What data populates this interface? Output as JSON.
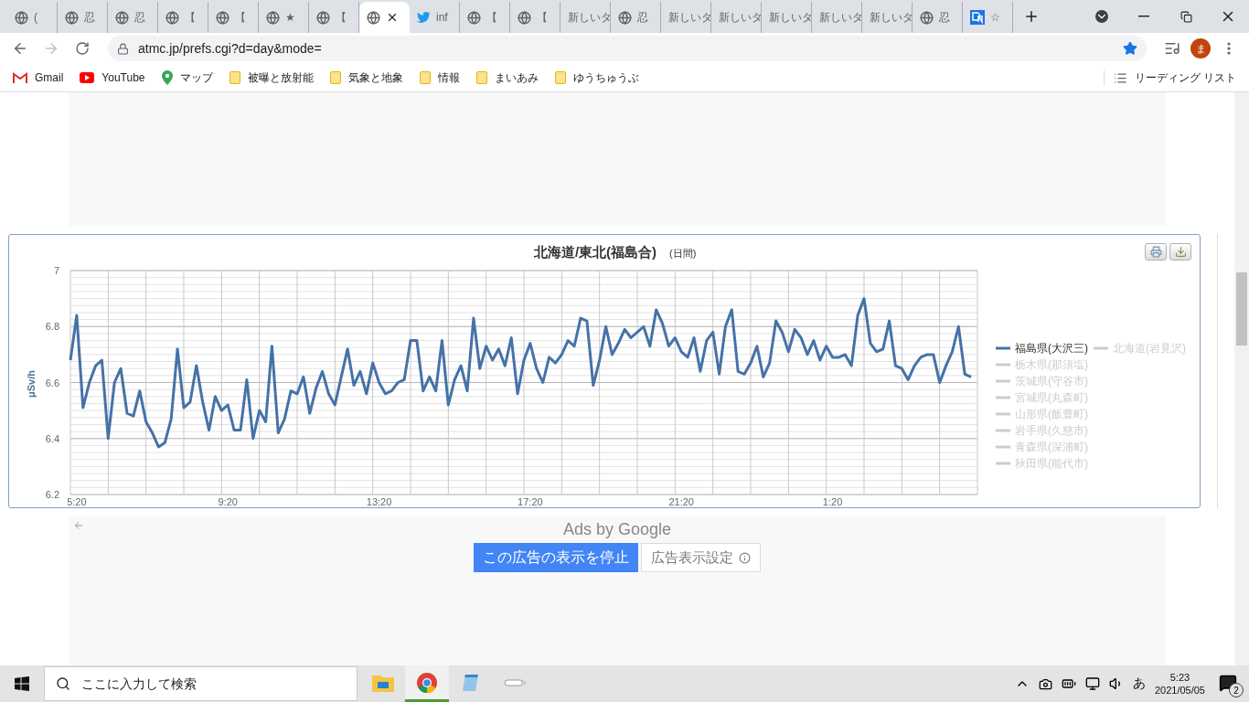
{
  "browser": {
    "tabs": [
      {
        "kind": "globe",
        "label": "(",
        "selected": false
      },
      {
        "kind": "globe",
        "label": "忍",
        "selected": false
      },
      {
        "kind": "globe",
        "label": "忍",
        "selected": false
      },
      {
        "kind": "globe",
        "label": "【",
        "selected": false
      },
      {
        "kind": "globe",
        "label": "【",
        "selected": false
      },
      {
        "kind": "globe",
        "label": "★",
        "selected": false
      },
      {
        "kind": "globe",
        "label": "【",
        "selected": false
      },
      {
        "kind": "globe",
        "selected": true
      },
      {
        "kind": "bird",
        "label": "inf",
        "selected": false
      },
      {
        "kind": "globe",
        "label": "【",
        "selected": false
      },
      {
        "kind": "globe",
        "label": "【",
        "selected": false
      },
      {
        "kind": "plain",
        "label": "新しいタ",
        "selected": false
      },
      {
        "kind": "globe",
        "label": "忍",
        "selected": false
      },
      {
        "kind": "plain",
        "label": "新しいタ",
        "selected": false
      },
      {
        "kind": "plain",
        "label": "新しいタ",
        "selected": false
      },
      {
        "kind": "plain",
        "label": "新しいタ",
        "selected": false
      },
      {
        "kind": "plain",
        "label": "新しいタ",
        "selected": false
      },
      {
        "kind": "plain",
        "label": "新しいタ",
        "selected": false
      },
      {
        "kind": "globe",
        "label": "忍",
        "selected": false
      },
      {
        "kind": "dn",
        "label": "☆",
        "selected": false
      }
    ],
    "url": "atmc.jp/prefs.cgi?d=day&mode=",
    "bookmarked": true,
    "profile_initial": "ま",
    "bookmarks": [
      {
        "kind": "gmail",
        "label": "Gmail"
      },
      {
        "kind": "youtube",
        "label": "YouTube"
      },
      {
        "kind": "maps",
        "label": "マップ"
      },
      {
        "kind": "folder",
        "label": "被曝と放射能"
      },
      {
        "kind": "folder",
        "label": "気象と地象"
      },
      {
        "kind": "folder",
        "label": "情報"
      },
      {
        "kind": "folder",
        "label": "まいあみ"
      },
      {
        "kind": "folder",
        "label": "ゆうちゅうぶ"
      }
    ],
    "reading_list": "リーディング リスト"
  },
  "chart": {
    "subtitle": "(日間)",
    "chart_data": {
      "type": "line",
      "title": "北海道/東北(福島合)",
      "ylabel": "μSv/h",
      "ylim": [
        6.2,
        7
      ],
      "grid": true,
      "yticks": [
        6.2,
        6.4,
        6.6,
        6.8,
        7
      ],
      "categories": [
        null,
        "5:20",
        null,
        null,
        null,
        null,
        null,
        null,
        null,
        null,
        null,
        null,
        null,
        null,
        null,
        null,
        null,
        null,
        null,
        null,
        null,
        null,
        null,
        null,
        null,
        "9:20",
        null,
        null,
        null,
        null,
        null,
        null,
        null,
        null,
        null,
        null,
        null,
        null,
        null,
        null,
        null,
        null,
        null,
        null,
        null,
        null,
        null,
        null,
        null,
        "13:20",
        null,
        null,
        null,
        null,
        null,
        null,
        null,
        null,
        null,
        null,
        null,
        null,
        null,
        null,
        null,
        null,
        null,
        null,
        null,
        null,
        null,
        null,
        null,
        "17:20",
        null,
        null,
        null,
        null,
        null,
        null,
        null,
        null,
        null,
        null,
        null,
        null,
        null,
        null,
        null,
        null,
        null,
        null,
        null,
        null,
        null,
        null,
        null,
        "21:20",
        null,
        null,
        null,
        null,
        null,
        null,
        null,
        null,
        null,
        null,
        null,
        null,
        null,
        null,
        null,
        null,
        null,
        null,
        null,
        null,
        null,
        null,
        null,
        "1:20",
        null,
        null,
        null,
        null,
        null,
        null,
        null,
        null,
        null,
        null,
        null,
        null,
        null,
        null,
        null,
        null,
        null,
        null,
        null,
        null,
        null,
        null
      ],
      "series": [
        {
          "name": "福島県(大沢三)",
          "color": "#4572a7",
          "values": [
            6.68,
            6.84,
            6.51,
            6.6,
            6.66,
            6.68,
            6.4,
            6.6,
            6.65,
            6.49,
            6.48,
            6.57,
            6.46,
            6.42,
            6.37,
            6.385,
            6.47,
            6.72,
            6.51,
            6.53,
            6.66,
            6.53,
            6.43,
            6.55,
            6.5,
            6.52,
            6.43,
            6.43,
            6.61,
            6.4,
            6.5,
            6.46,
            6.73,
            6.42,
            6.47,
            6.57,
            6.56,
            6.62,
            6.49,
            6.58,
            6.64,
            6.56,
            6.52,
            6.62,
            6.72,
            6.59,
            6.64,
            6.56,
            6.67,
            6.6,
            6.56,
            6.57,
            6.6,
            6.61,
            6.75,
            6.75,
            6.57,
            6.62,
            6.57,
            6.75,
            6.52,
            6.61,
            6.66,
            6.57,
            6.83,
            6.65,
            6.73,
            6.68,
            6.72,
            6.66,
            6.76,
            6.56,
            6.68,
            6.74,
            6.65,
            6.6,
            6.69,
            6.67,
            6.7,
            6.75,
            6.73,
            6.83,
            6.82,
            6.59,
            6.68,
            6.8,
            6.7,
            6.74,
            6.79,
            6.76,
            6.78,
            6.8,
            6.73,
            6.86,
            6.81,
            6.73,
            6.76,
            6.71,
            6.69,
            6.76,
            6.64,
            6.75,
            6.78,
            6.63,
            6.8,
            6.86,
            6.64,
            6.63,
            6.67,
            6.73,
            6.62,
            6.67,
            6.82,
            6.78,
            6.71,
            6.79,
            6.76,
            6.7,
            6.75,
            6.68,
            6.73,
            6.69,
            6.69,
            6.7,
            6.66,
            6.84,
            6.9,
            6.74,
            6.71,
            6.72,
            6.82,
            6.66,
            6.65,
            6.61,
            6.66,
            6.69,
            6.7,
            6.7,
            6.6,
            6.66,
            6.71,
            6.8,
            6.63,
            6.62
          ]
        }
      ]
    },
    "hidden_series": [
      {
        "label": "北海道(岩見沢)",
        "visible": false
      },
      {
        "label": "栃木県(那須塩)",
        "visible": false
      },
      {
        "label": "茨城県(守谷市)",
        "visible": false
      },
      {
        "label": "宮城県(丸森町)",
        "visible": false
      },
      {
        "label": "山形県(飯豊町)",
        "visible": false
      },
      {
        "label": "岩手県(久慈市)",
        "visible": false
      },
      {
        "label": "青森県(深浦町)",
        "visible": false
      },
      {
        "label": "秋田県(能代市)",
        "visible": false
      }
    ]
  },
  "ads": {
    "label": "Ads by Google",
    "stop_button": "この広告の表示を停止",
    "settings_button": "広告表示設定"
  },
  "taskbar": {
    "search_placeholder": "ここに入力して検索",
    "ime": "あ",
    "time": "5:23",
    "date": "2021/05/05",
    "notifications": "2"
  }
}
